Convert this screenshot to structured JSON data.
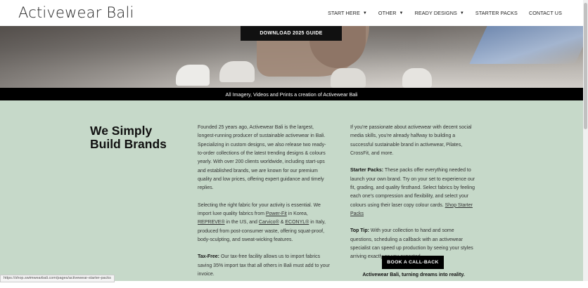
{
  "header": {
    "logo": "Activewear Bali",
    "nav": [
      {
        "label": "START HERE",
        "has_dropdown": true
      },
      {
        "label": "OTHER",
        "has_dropdown": true
      },
      {
        "label": "READY DESIGNS",
        "has_dropdown": true
      },
      {
        "label": "STARTER PACKS",
        "has_dropdown": false
      },
      {
        "label": "CONTACT US",
        "has_dropdown": false
      }
    ]
  },
  "hero": {
    "download_button": "DOWNLOAD 2025 GUIDE",
    "banner": "All Imagery, Videos and Prints a creation of Activewear Bali"
  },
  "main": {
    "heading_line1": "We Simply",
    "heading_line2": "Build Brands",
    "col1": {
      "p1": "Founded 25 years ago, Activewear Bali is the largest, longest-running producer of sustainable activewear in Bali. Specializing in custom designs, we also release two ready-to-order collections of the latest trending designs & colours yearly. With over 200 clients worldwide, including start-ups and established brands, we are known for our premium quality and low prices, offering expert guidance and timely replies.",
      "p2_a": "Selecting the right fabric for your activity is essential. We import luxe quality fabrics from ",
      "p2_link1": "Power-Fit",
      "p2_b": " in Korea, ",
      "p2_link2": "REPREVE®",
      "p2_c": " in the US, and ",
      "p2_link3": "Carvico®",
      "p2_d": " & ",
      "p2_link4": "ECONYL®",
      "p2_e": " in Italy, produced from post-consumer waste, offering squat-proof, body-sculpting, and sweat-wicking features.",
      "p3_label": "Tax-Free:",
      "p3_text": " Our tax-free facility allows us to import fabrics saving 35% import tax that all others in Bali must add to your invoice."
    },
    "col2": {
      "p1": "If you're passionate about activewear with decent social media skills, you're already halfway to building a successful sustainable brand in activewear, Pilates, CrossFit, and more.",
      "p2_label": "Starter Packs:",
      "p2_text": " These packs offer everything needed to launch your own brand. Try on your set to experience our fit, grading, and quality firsthand. Select fabrics by feeling each one's compression and flexibility, and select your colours using their laser copy colour cards. ",
      "p2_link": "Shop Starter Packs",
      "p3_label": "Top Tip:",
      "p3_text": " With your collection to hand and some questions, scheduling a callback with an activewear specialist can speed up production by seeing your styles arriving exactly as you expected."
    },
    "callback_button": "BOOK A CALL-BACK",
    "tagline": "Activewear Bali, turning dreams into reality."
  },
  "status_url": "https://shop.swimwearbali.com/pages/activewear-starter-packs",
  "colors": {
    "main_bg": "#c6d9c9",
    "button_bg": "#000000",
    "banner_bg": "#000000"
  }
}
